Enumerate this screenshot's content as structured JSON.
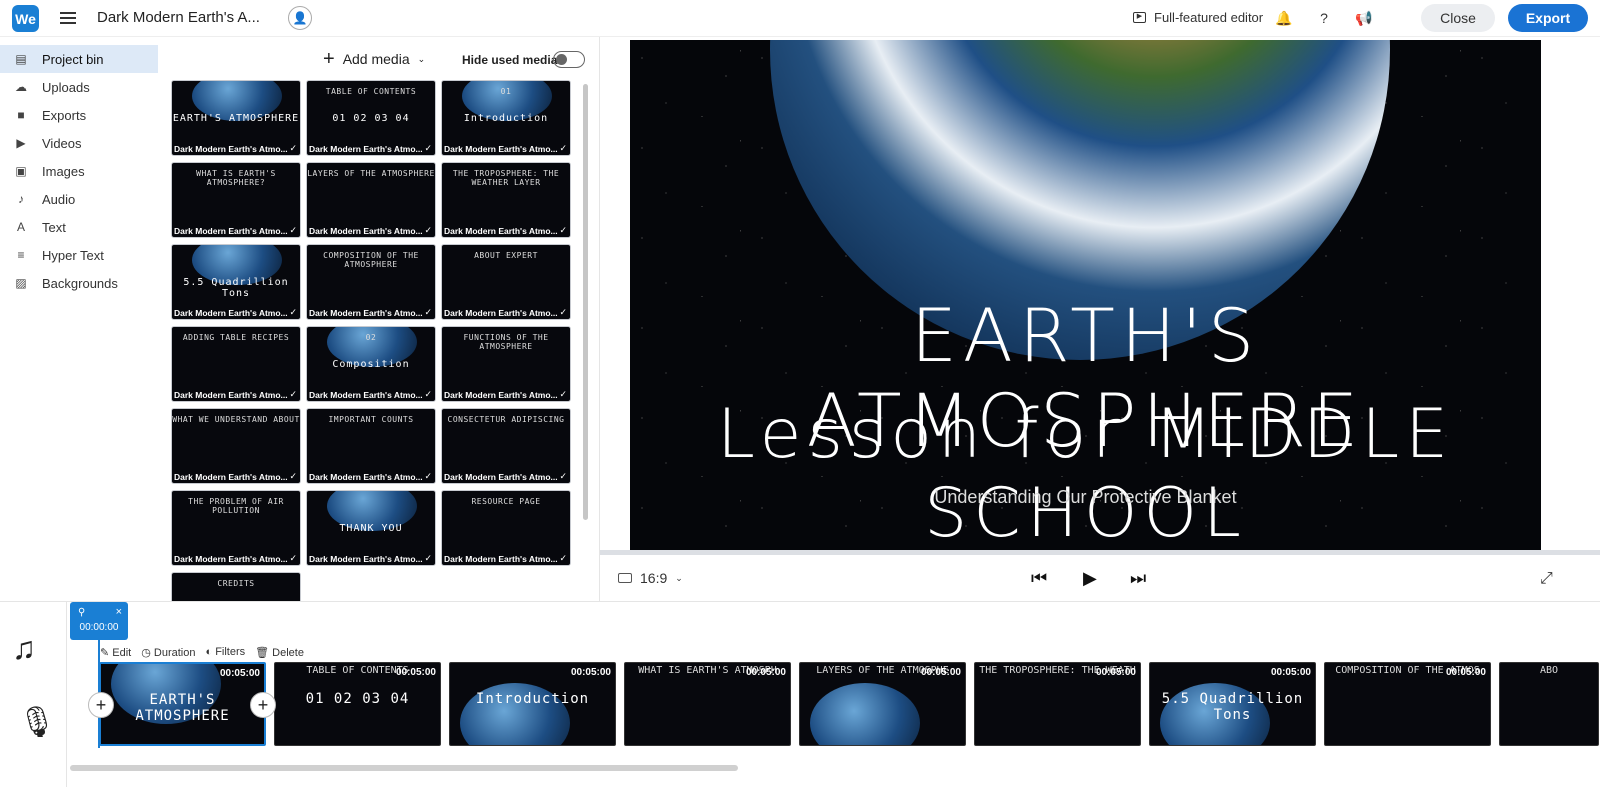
{
  "header": {
    "logo_text": "We",
    "project_title": "Dark Modern Earth's A...",
    "full_editor_label": "Full-featured editor",
    "close_label": "Close",
    "export_label": "Export",
    "icons": [
      "menu-icon",
      "share-user-icon",
      "bell-icon",
      "help-icon",
      "announce-icon"
    ]
  },
  "sidebar": {
    "items": [
      {
        "label": "Project bin",
        "icon": "▤",
        "active": true
      },
      {
        "label": "Uploads",
        "icon": "☁"
      },
      {
        "label": "Exports",
        "icon": "■"
      },
      {
        "label": "Videos",
        "icon": "▶"
      },
      {
        "label": "Images",
        "icon": "▣"
      },
      {
        "label": "Audio",
        "icon": "♪"
      },
      {
        "label": "Text",
        "icon": "A"
      },
      {
        "label": "Hyper Text",
        "icon": "≡"
      },
      {
        "label": "Backgrounds",
        "icon": "▨"
      }
    ]
  },
  "bin": {
    "add_media_label": "Add media",
    "hide_used_label": "Hide used media",
    "thumbnail_caption": "Dark Modern Earth's Atmo...",
    "thumbs": [
      {
        "title": "",
        "big": "EARTH'S ATMOSPHERE"
      },
      {
        "title": "TABLE OF CONTENTS",
        "big": "01  02  03  04"
      },
      {
        "title": "01",
        "big": "Introduction"
      },
      {
        "title": "WHAT IS EARTH'S ATMOSPHERE?",
        "big": ""
      },
      {
        "title": "LAYERS OF THE ATMOSPHERE",
        "big": ""
      },
      {
        "title": "THE TROPOSPHERE: THE WEATHER LAYER",
        "big": ""
      },
      {
        "title": "",
        "big": "5.5 Quadrillion Tons"
      },
      {
        "title": "COMPOSITION OF THE ATMOSPHERE",
        "big": ""
      },
      {
        "title": "ABOUT EXPERT",
        "big": ""
      },
      {
        "title": "ADDING TABLE RECIPES",
        "big": ""
      },
      {
        "title": "02",
        "big": "Composition"
      },
      {
        "title": "FUNCTIONS OF THE ATMOSPHERE",
        "big": ""
      },
      {
        "title": "WHAT WE UNDERSTAND ABOUT",
        "big": ""
      },
      {
        "title": "IMPORTANT COUNTS",
        "big": ""
      },
      {
        "title": "CONSECTETUR ADIPISCING",
        "big": ""
      },
      {
        "title": "THE PROBLEM OF AIR POLLUTION",
        "big": ""
      },
      {
        "title": "",
        "big": "THANK YOU"
      },
      {
        "title": "RESOURCE PAGE",
        "big": ""
      },
      {
        "title": "CREDITS",
        "big": ""
      }
    ]
  },
  "preview": {
    "title_line1": "EARTH'S ATMOSPHERE",
    "title_line2": "Lesson for MIDDLE SCHOOL",
    "subtitle": "Understanding Our Protective Blanket",
    "aspect_ratio": "16:9"
  },
  "timeline": {
    "playhead_time": "00:00:00",
    "tools": {
      "edit": "Edit",
      "duration": "Duration",
      "filters": "Filters",
      "delete": "Delete"
    },
    "clips": [
      {
        "title": "",
        "big": "EARTH'S ATMOSPHERE",
        "duration": "00:05:00"
      },
      {
        "title": "TABLE OF CONTENTS",
        "big": "01  02  03  04",
        "duration": "00:05:00"
      },
      {
        "title": "",
        "big": "Introduction",
        "duration": "00:05:00"
      },
      {
        "title": "WHAT IS EARTH'S ATMOSPH",
        "big": "",
        "duration": "00:05:00"
      },
      {
        "title": "LAYERS OF THE ATMOSPHE",
        "big": "",
        "duration": "00:05:00"
      },
      {
        "title": "THE TROPOSPHERE: THE WEATH",
        "big": "",
        "duration": "00:05:00"
      },
      {
        "title": "",
        "big": "5.5 Quadrillion Tons",
        "duration": "00:05:00"
      },
      {
        "title": "COMPOSITION OF THE ATMOS",
        "big": "",
        "duration": "00:05:00"
      },
      {
        "title": "ABO",
        "big": "",
        "duration": ""
      }
    ]
  },
  "colors": {
    "accent": "#1a7fd4",
    "export": "#1a73d4",
    "active_bg": "#dde9f7"
  }
}
